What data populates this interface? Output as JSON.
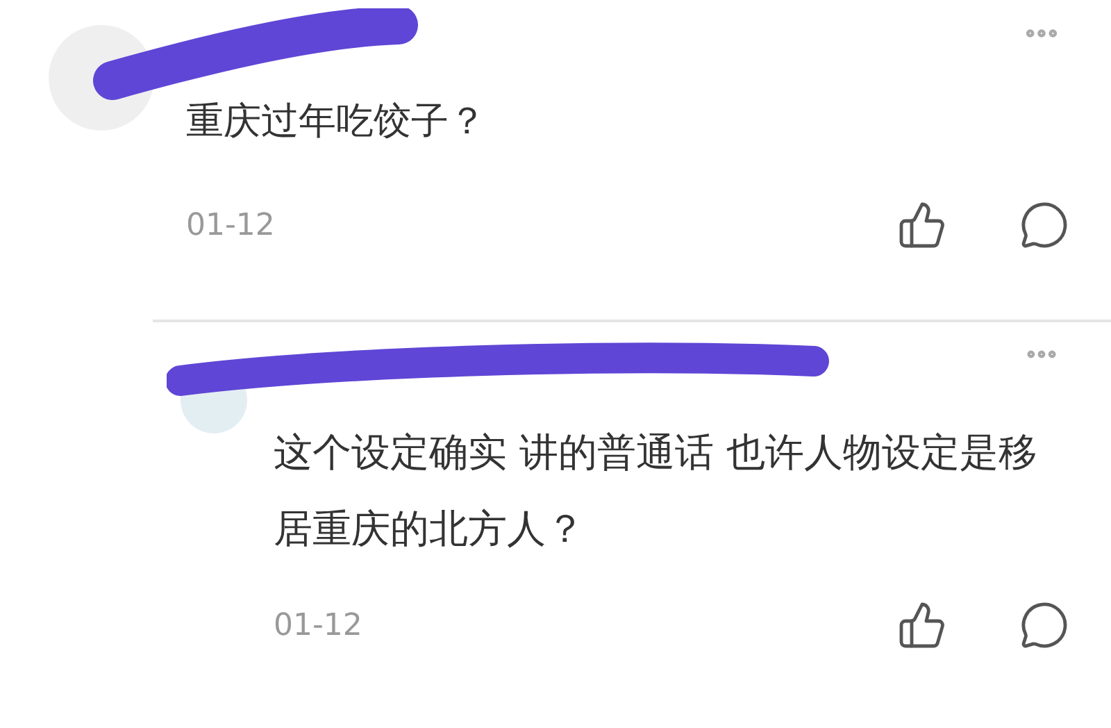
{
  "comments": [
    {
      "kind": "top",
      "text": "重庆过年吃饺子？",
      "date": "01-12"
    },
    {
      "kind": "reply",
      "text": "这个设定确实 讲的普通话 也许人物设定是移居重庆的北方人？",
      "date": "01-12"
    }
  ]
}
